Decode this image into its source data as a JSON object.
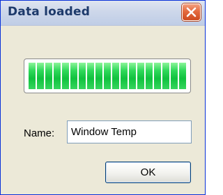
{
  "window": {
    "title": "Data loaded",
    "close_icon": "close-icon"
  },
  "progress": {
    "fraction": 1.0,
    "color": "#10c23e"
  },
  "form": {
    "name_label": "Name:",
    "name_value": "Window Temp"
  },
  "buttons": {
    "ok_label": "OK"
  },
  "colors": {
    "dialog_background": "#ece9d8",
    "close_button": "#e46a3f",
    "title_text": "#1d3a6b"
  }
}
